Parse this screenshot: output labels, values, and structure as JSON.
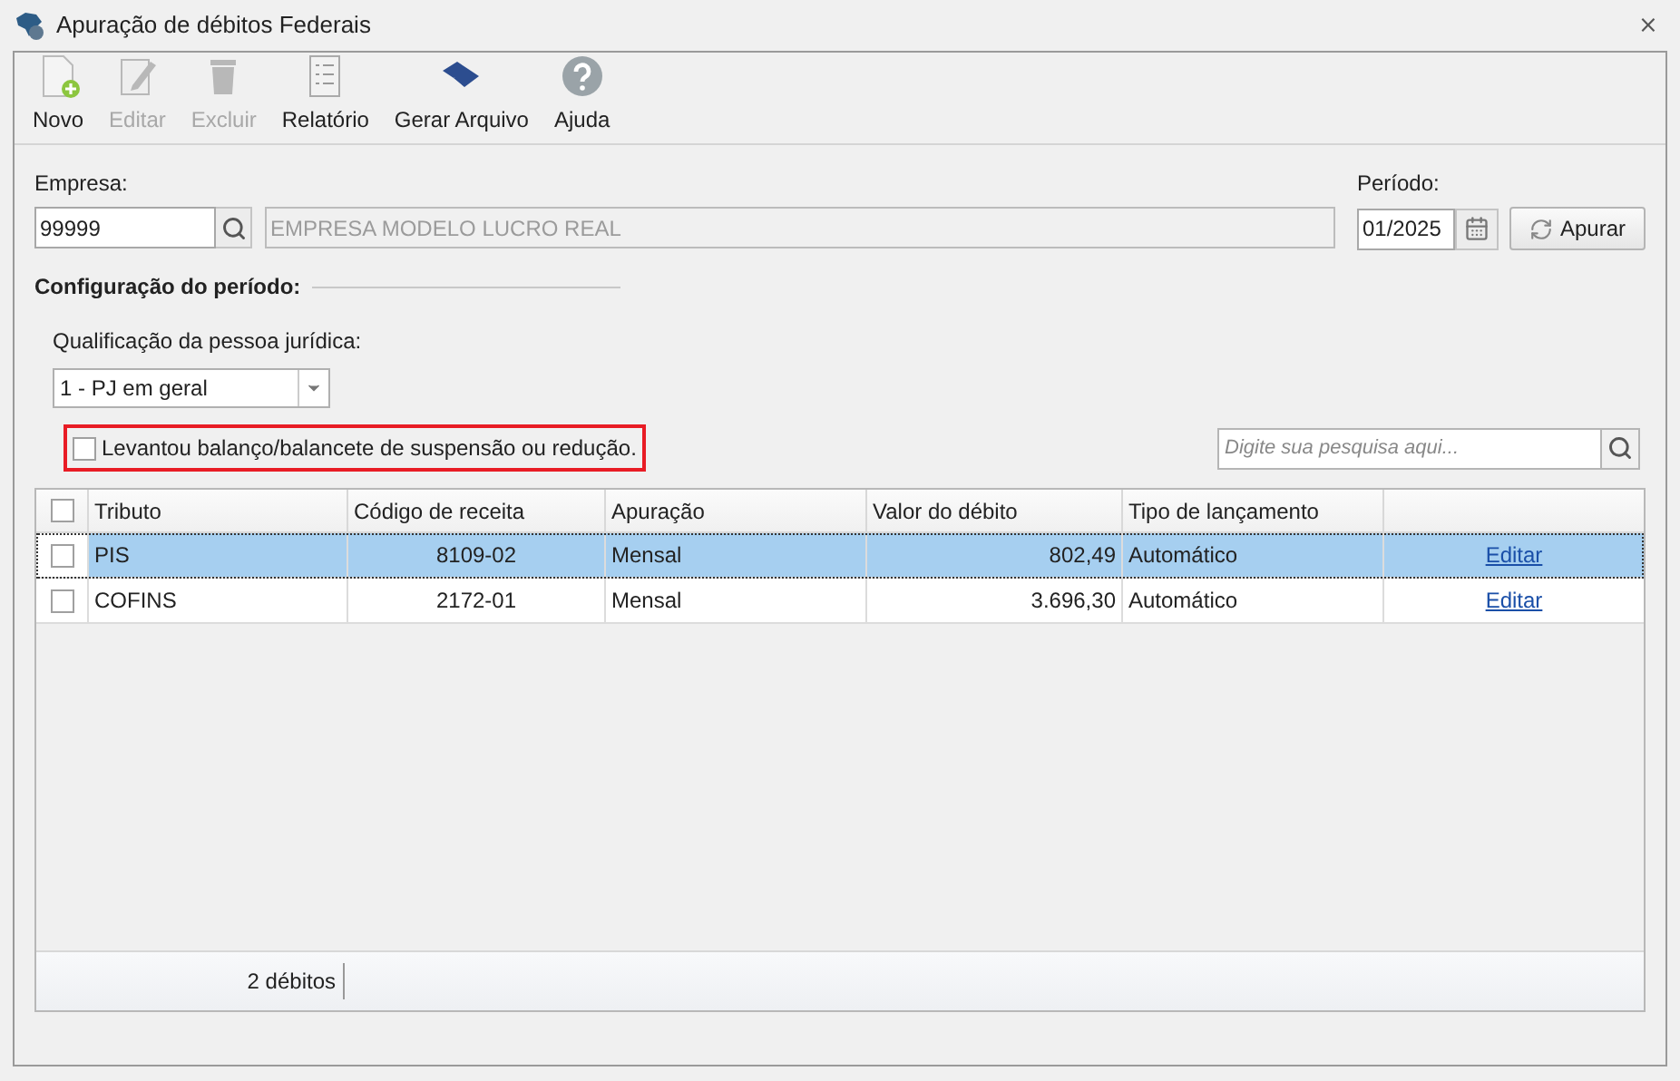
{
  "window": {
    "title": "Apuração de débitos Federais",
    "close": "⨯"
  },
  "toolbar": [
    {
      "label": "Novo",
      "kind": "new",
      "disabled": false
    },
    {
      "label": "Editar",
      "kind": "edit",
      "disabled": true
    },
    {
      "label": "Excluir",
      "kind": "delete",
      "disabled": true
    },
    {
      "label": "Relatório",
      "kind": "report",
      "disabled": false
    },
    {
      "label": "Gerar Arquivo",
      "kind": "export",
      "disabled": false
    },
    {
      "label": "Ajuda",
      "kind": "help",
      "disabled": false
    }
  ],
  "empresa": {
    "label": "Empresa:",
    "code": "99999",
    "name": "EMPRESA MODELO LUCRO REAL"
  },
  "periodo": {
    "label": "Período:",
    "value": "01/2025",
    "button": "Apurar"
  },
  "config": {
    "title": "Configuração do período:",
    "qualificacao_label": "Qualificação da pessoa jurídica:",
    "qualificacao": "1 - PJ em geral",
    "balanco": {
      "label": "Levantou balanço/balancete de suspensão ou redução.",
      "checked": false,
      "highlighted": true
    }
  },
  "search": {
    "placeholder": "Digite sua pesquisa aqui..."
  },
  "table": {
    "columns": [
      "Tributo",
      "Código de receita",
      "Apuração",
      "Valor do débito",
      "Tipo de lançamento"
    ],
    "all_checked": false,
    "rows": [
      {
        "selected": true,
        "checked": false,
        "cells": [
          "PIS",
          "8109-02",
          "Mensal",
          "802,49",
          "Automático"
        ],
        "action": "Editar"
      },
      {
        "selected": false,
        "checked": false,
        "cells": [
          "COFINS",
          "2172-01",
          "Mensal",
          "3.696,30",
          "Automático"
        ],
        "action": "Editar"
      }
    ],
    "footer": "2 débitos"
  }
}
